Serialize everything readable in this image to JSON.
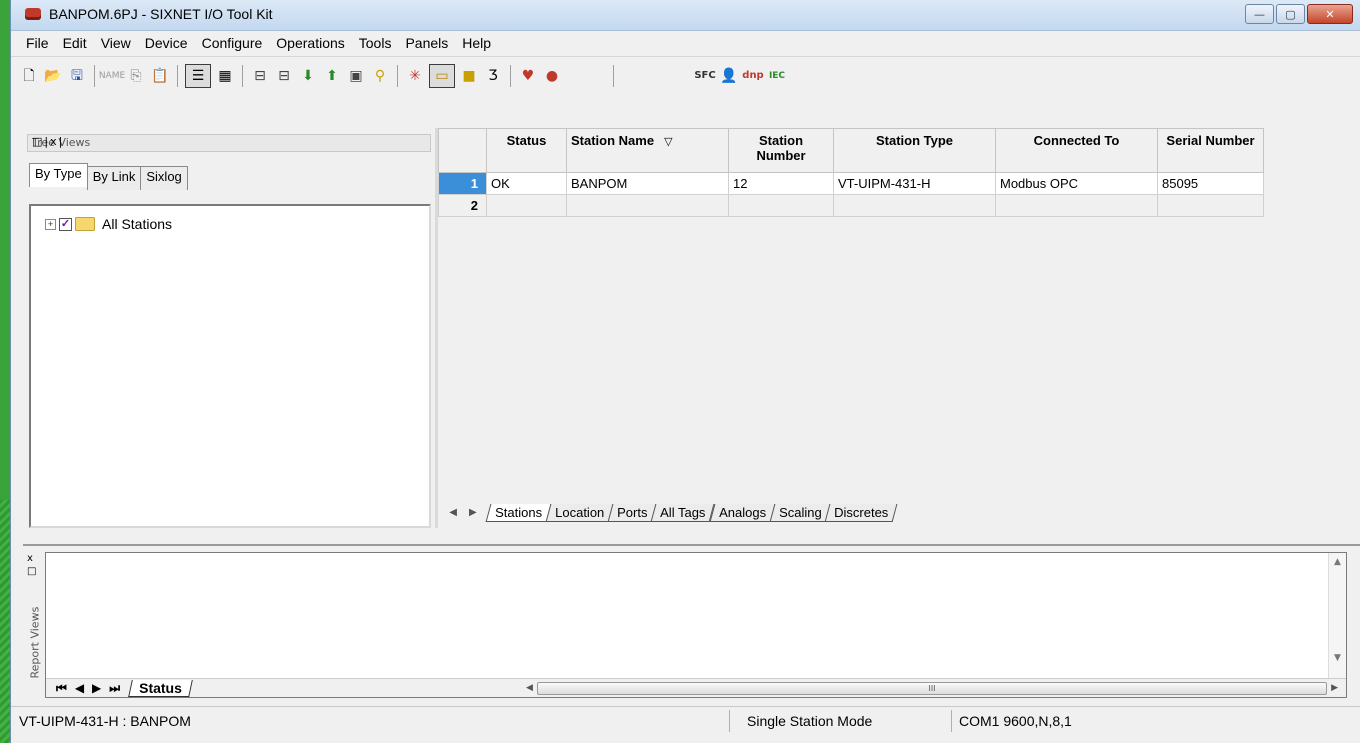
{
  "window": {
    "title": "BANPOM.6PJ - SIXNET I/O Tool Kit",
    "buttons": {
      "minimize": "—",
      "maximize": "▢",
      "close": "✕"
    }
  },
  "menu": [
    "File",
    "Edit",
    "View",
    "Device",
    "Configure",
    "Operations",
    "Tools",
    "Panels",
    "Help"
  ],
  "toolbar": {
    "icons": [
      "new-icon",
      "open-icon",
      "save-icon",
      "rename-icon",
      "copy-icon",
      "paste-icon",
      "list-view-icon",
      "grid-view-icon",
      "add-station-icon",
      "station-icon",
      "download-icon",
      "upload-icon",
      "read-icon",
      "find-icon",
      "io-test-icon",
      "monitor-icon",
      "module-icon",
      "tool-icon",
      "diagnostic-icon",
      "event-icon",
      "sfc-icon",
      "user-icon",
      "dnp-icon",
      "iec-icon"
    ],
    "label_top_right": "IEC"
  },
  "tree": {
    "header": "Tree Views",
    "header_ctrls": "□|x|",
    "tabs": [
      "By Type",
      "By Link",
      "Sixlog"
    ],
    "root_label": "All Stations"
  },
  "grid": {
    "columns": [
      "Status",
      "Station Name",
      "Station Number",
      "Station Type",
      "Connected To",
      "Serial Number"
    ],
    "sort_mark": "▽",
    "rows": [
      {
        "num": "1",
        "status": "OK",
        "name": "BANPOM",
        "number": "12",
        "type": "VT-UIPM-431-H",
        "connected": "Modbus OPC",
        "serial": "85095"
      },
      {
        "num": "2",
        "status": "",
        "name": "",
        "number": "",
        "type": "",
        "connected": "",
        "serial": ""
      }
    ]
  },
  "sheet_tabs": [
    "Stations",
    "Location",
    "Ports",
    "All Tags",
    "Analogs",
    "Scaling",
    "Discretes"
  ],
  "report": {
    "side_label": "Report Views",
    "side_ctrls": "x\n□|x",
    "tab": "Status",
    "scroll_mark": "III"
  },
  "statusbar": {
    "left": "VT-UIPM-431-H : BANPOM",
    "mode": "Single Station Mode",
    "port": "COM1 9600,N,8,1"
  }
}
